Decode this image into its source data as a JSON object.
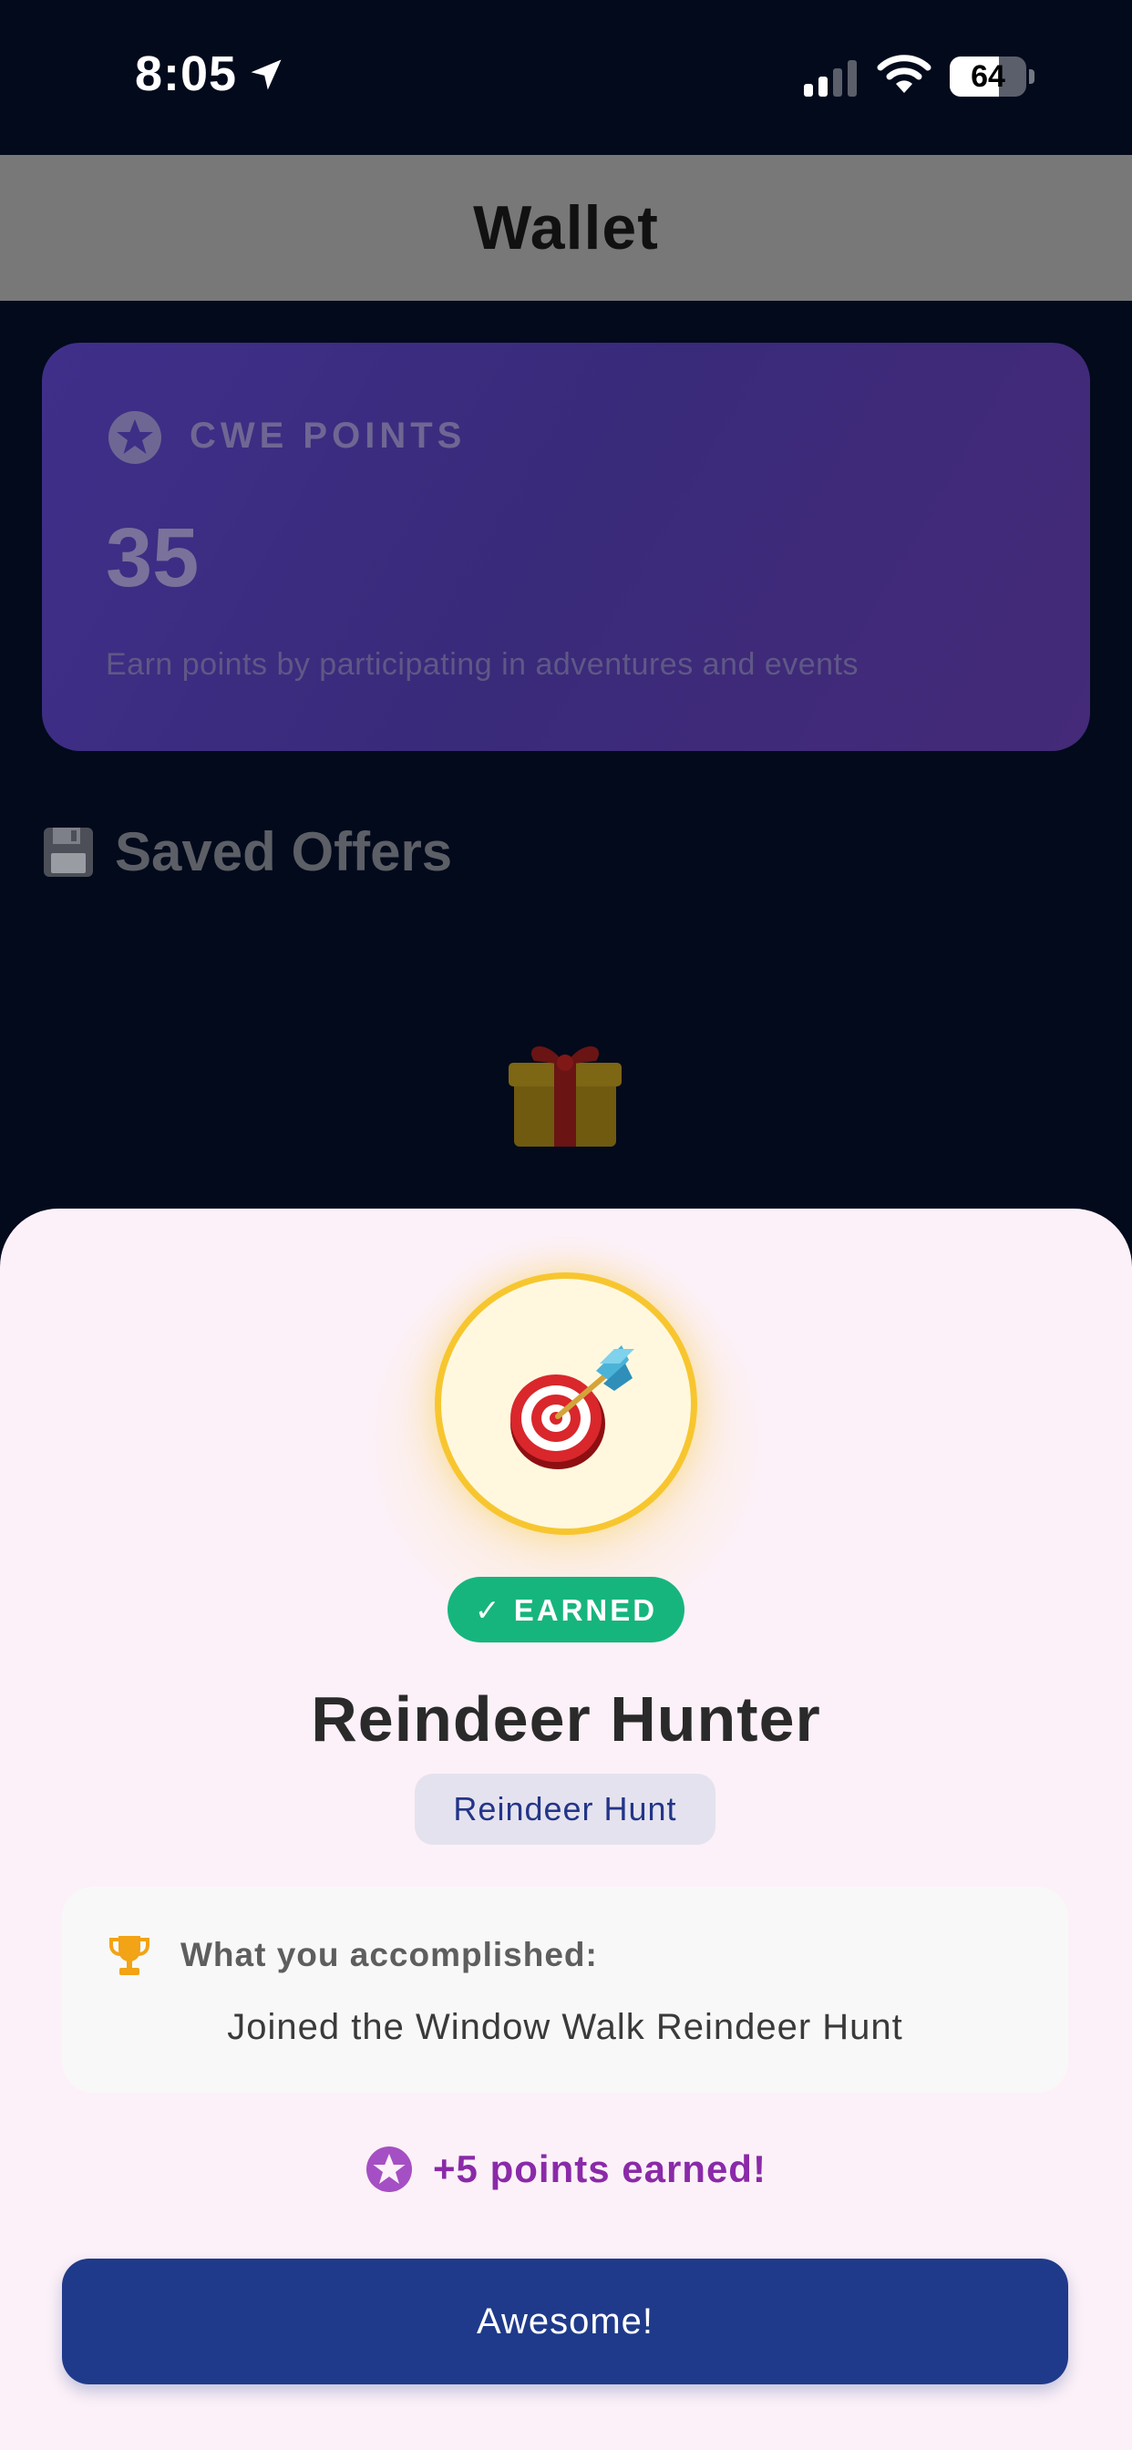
{
  "status_bar": {
    "time": "8:05",
    "battery_level": "64",
    "icons": [
      "location-arrow-icon",
      "cellular-signal-icon",
      "wifi-icon",
      "battery-icon"
    ]
  },
  "header": {
    "title": "Wallet"
  },
  "points_card": {
    "label": "CWE POINTS",
    "value": "35",
    "description": "Earn points by participating in adventures and events",
    "icon": "star-circle-icon"
  },
  "saved_offers": {
    "title": "Saved Offers",
    "icon": "floppy-disk-icon",
    "empty_icon": "gift-icon"
  },
  "achievement_sheet": {
    "badge_icon": "target-dart-icon",
    "status": "✓ EARNED",
    "title": "Reindeer Hunter",
    "category": "Reindeer Hunt",
    "accomplished_label": "What you accomplished:",
    "accomplished_text": "Joined the Window Walk Reindeer Hunt",
    "points_text": "+5 points earned!",
    "button_label": "Awesome!"
  },
  "colors": {
    "background": "#020a1c",
    "header": "#787878",
    "points_card": "#3f2f8a",
    "sheet": "#fcf1f8",
    "badge_ring": "#f7c62f",
    "earned_green": "#17b57e",
    "category_text": "#223588",
    "points_purple": "#8a2aa8",
    "primary_button": "#1f3a8a"
  }
}
